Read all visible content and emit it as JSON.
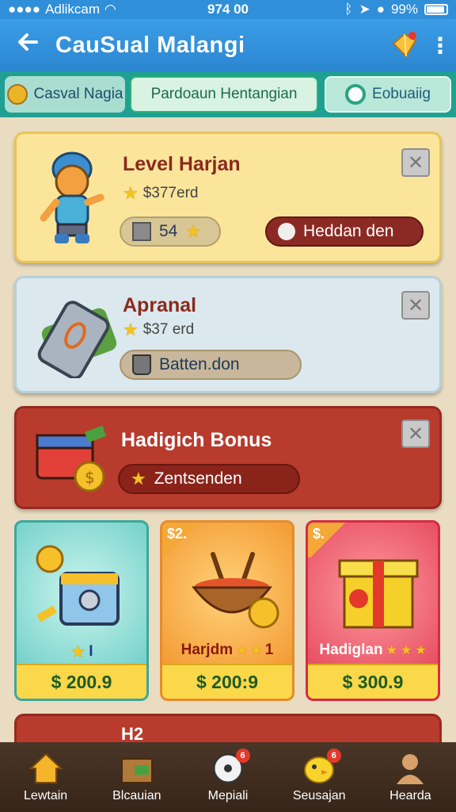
{
  "status_bar": {
    "carrier": "Adlikcam",
    "time": "974 00",
    "battery": "99%"
  },
  "app_bar": {
    "title": "CauSual Malangi"
  },
  "tabs": [
    {
      "label": "Casval Nagia"
    },
    {
      "label": "Pardoaun Hentangian"
    },
    {
      "label": "Eobuaiig"
    }
  ],
  "cards": [
    {
      "title": "Level Harjan",
      "subtitle": "$377erd",
      "count": "54",
      "action": "Heddan den"
    },
    {
      "title": "Apranal",
      "subtitle": "$37 erd",
      "action": "Batten.don"
    },
    {
      "title": "Hadigich Bonus",
      "action": "Zentsenden"
    }
  ],
  "shop": [
    {
      "label": "I",
      "price": "$ 200.9",
      "ribbon": ""
    },
    {
      "label": "Harjdm",
      "stars_text": "1",
      "price": "$ 200:9",
      "ribbon": "$2."
    },
    {
      "label": "Hadiglan",
      "price": "$ 300.9",
      "ribbon": "$."
    }
  ],
  "peek": {
    "title": "H2"
  },
  "bottom_nav": [
    {
      "label": "Lewtain",
      "badge": ""
    },
    {
      "label": "Blcauian",
      "badge": ""
    },
    {
      "label": "Mepiali",
      "badge": "6"
    },
    {
      "label": "Seusajan",
      "badge": "6"
    },
    {
      "label": "Hearda",
      "badge": ""
    }
  ],
  "colors": {
    "app_bar": "#2f8fd8",
    "tabs_bg": "#1fa092",
    "bonus_card": "#b83b2e",
    "price_bar": "#fbd84a"
  }
}
